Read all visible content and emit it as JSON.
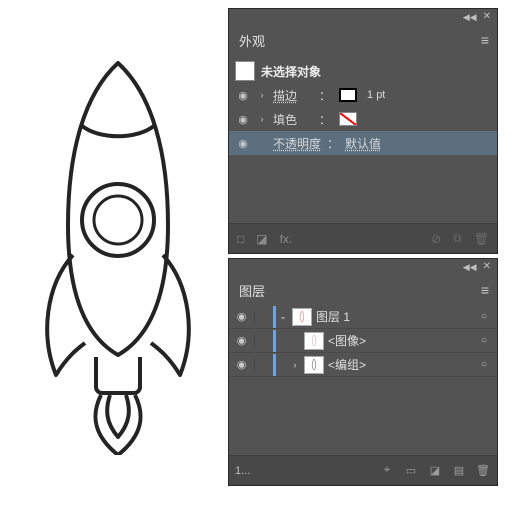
{
  "appearance": {
    "tab": "外观",
    "no_selection": "未选择对象",
    "stroke": {
      "label": "描边",
      "value": "1 pt"
    },
    "fill": {
      "label": "填色"
    },
    "opacity": {
      "label": "不透明度",
      "value": "默认值"
    },
    "close_glyph": "◀◀",
    "x_glyph": "✕",
    "menu_glyph": "≡",
    "fx_glyph": "fx.",
    "cancel_glyph": "⊘",
    "dup_glyph": "⧉",
    "trash_glyph": "🗑"
  },
  "layers": {
    "tab": "图层",
    "items": [
      {
        "name": "图层 1",
        "expanded": true,
        "indent": 0
      },
      {
        "name": "<图像>",
        "expanded": false,
        "indent": 1,
        "no_chev": true
      },
      {
        "name": "<编组>",
        "expanded": false,
        "indent": 1
      }
    ],
    "count_label": "1...",
    "menu_glyph": "≡"
  },
  "glyph": {
    "eye": "◉",
    "right": "›",
    "down": "⌄",
    "circle": "○",
    "sq_empty": "□",
    "sq_fill": "◪"
  }
}
